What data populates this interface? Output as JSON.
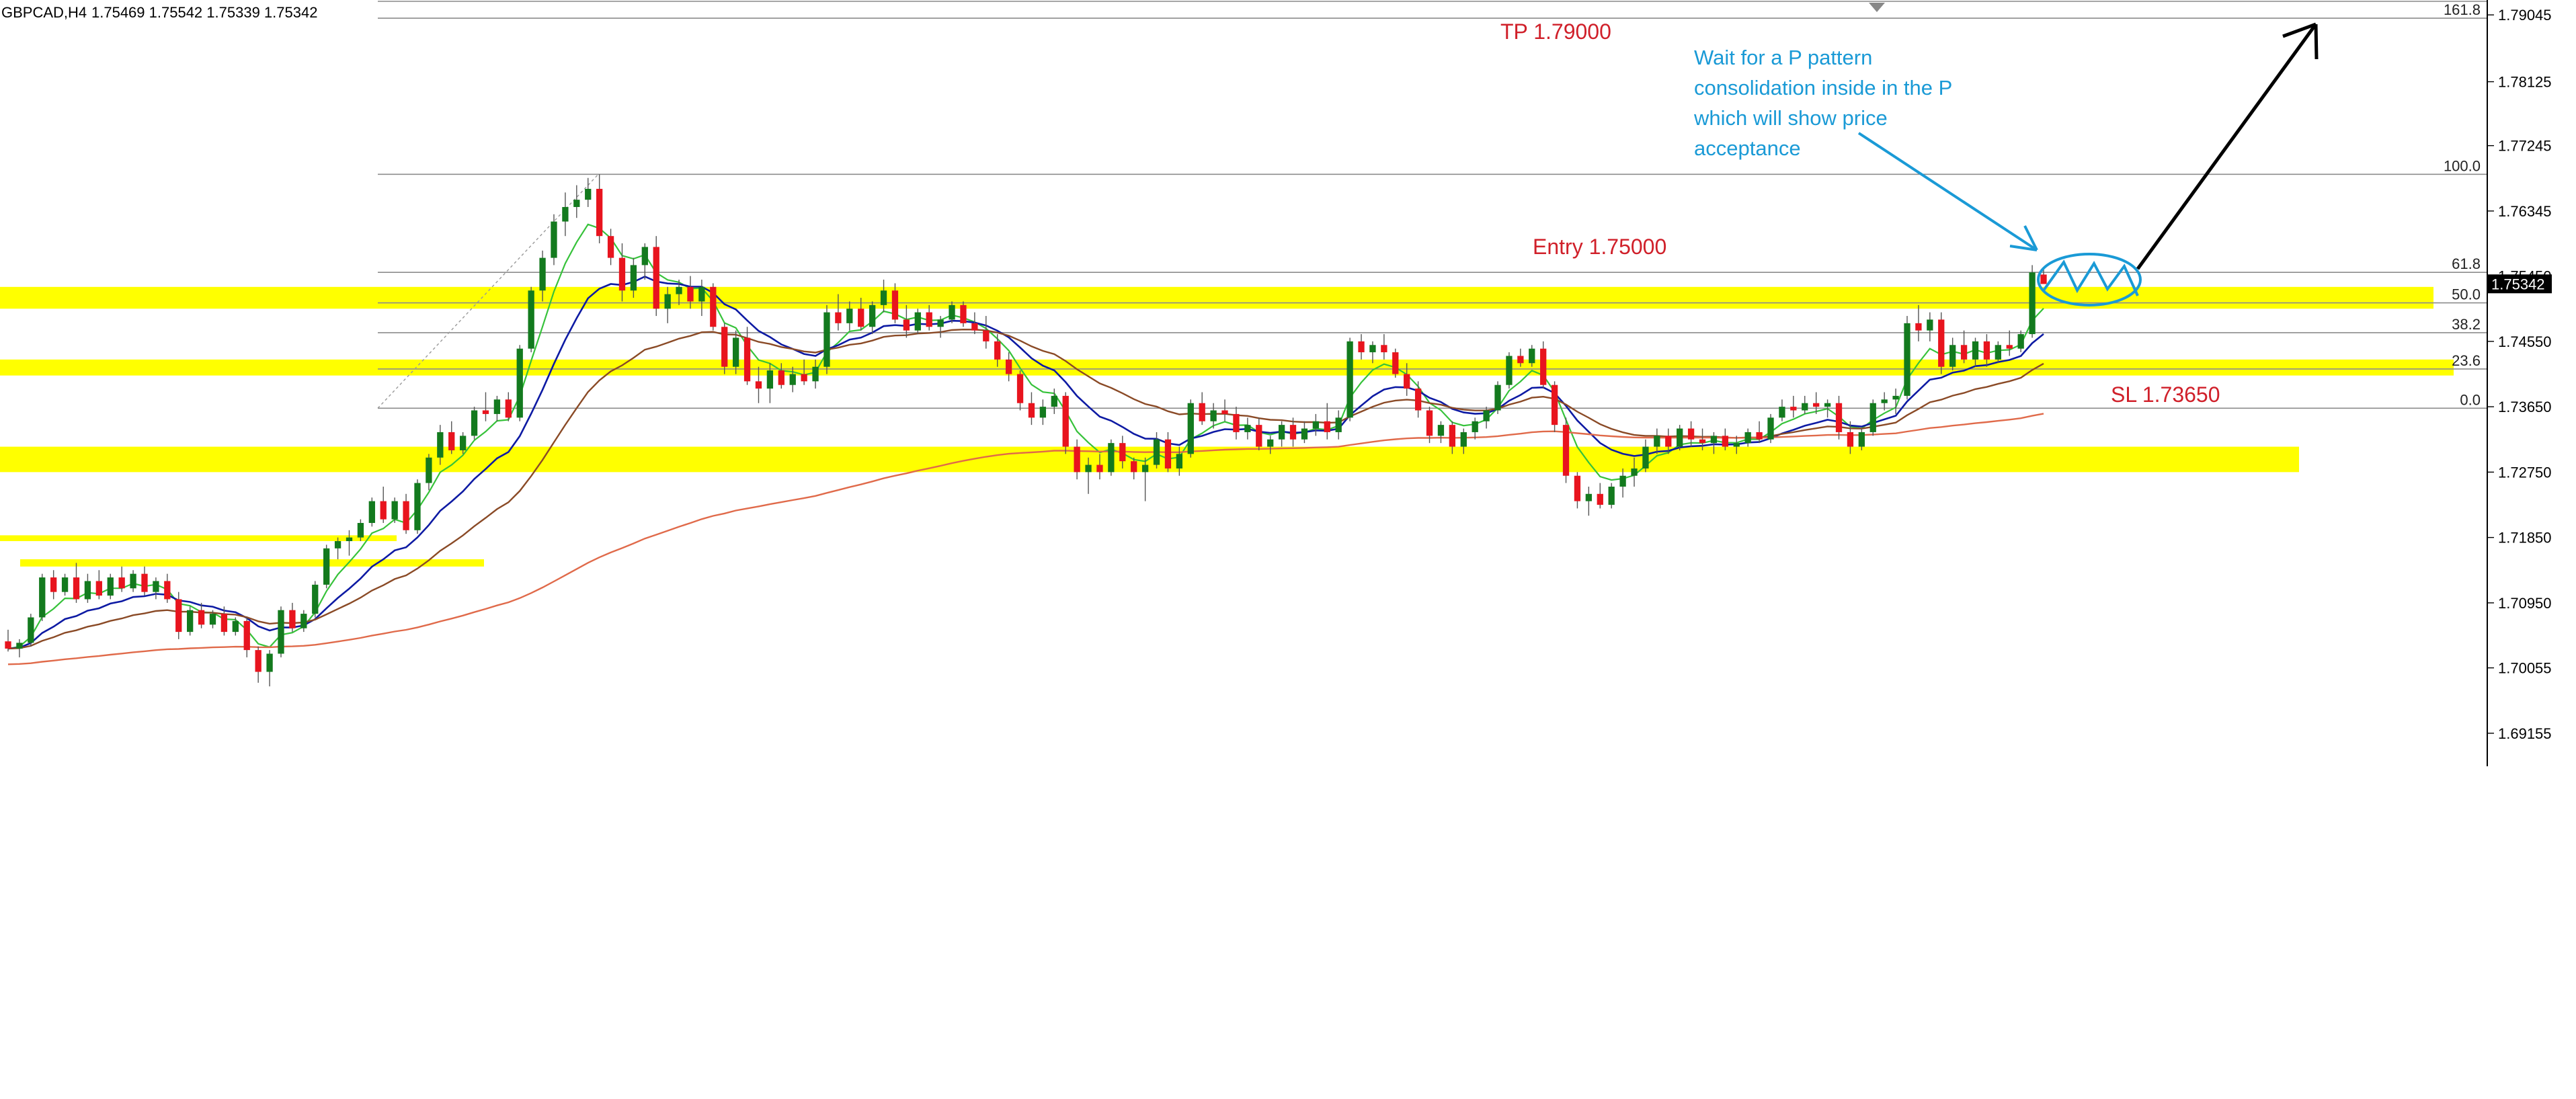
{
  "header": {
    "symbol_timeframe": "GBPCAD,H4",
    "ohlc": "1.75469 1.75542 1.75339 1.75342"
  },
  "colors": {
    "background": "#ffffff",
    "bull": "#137a1e",
    "bear": "#e8141e",
    "zone": "#ffff00",
    "ema_fast": "#36c23a",
    "ema_mid": "#0d1aa3",
    "ema_slow": "#8a4a26",
    "ema_long": "#e06a4a",
    "fib": "#8c8c8c",
    "annotation_red": "#d0202a",
    "annotation_blue": "#1a9ad6",
    "arrow_black": "#000000"
  },
  "annotations": {
    "tp": "TP 1.79000",
    "entry": "Entry 1.75000",
    "sl": "SL 1.73650",
    "note": [
      "Wait for a P pattern",
      "consolidation inside in the P",
      "which will show price",
      "acceptance"
    ]
  },
  "chart_data": {
    "type": "candlestick",
    "symbol": "GBPCAD",
    "timeframe": "H4",
    "ylim": [
      1.687,
      1.7925
    ],
    "price_axis_ticks": [
      "1.79045",
      "1.78125",
      "1.77245",
      "1.76345",
      "1.75450",
      "1.74550",
      "1.73650",
      "1.72750",
      "1.71850",
      "1.70950",
      "1.70055",
      "1.69155"
    ],
    "current_price": "1.75342",
    "candles_approx": [
      [
        1.7042,
        1.7058,
        1.7028,
        1.7032
      ],
      [
        1.7032,
        1.7045,
        1.702,
        1.704
      ],
      [
        1.704,
        1.708,
        1.7035,
        1.7075
      ],
      [
        1.7075,
        1.7135,
        1.707,
        1.713
      ],
      [
        1.713,
        1.714,
        1.71,
        1.711
      ],
      [
        1.711,
        1.7135,
        1.7105,
        1.713
      ],
      [
        1.713,
        1.715,
        1.7095,
        1.71
      ],
      [
        1.71,
        1.7135,
        1.7095,
        1.7125
      ],
      [
        1.7125,
        1.714,
        1.71,
        1.7105
      ],
      [
        1.7105,
        1.7135,
        1.71,
        1.713
      ],
      [
        1.713,
        1.7145,
        1.711,
        1.7115
      ],
      [
        1.7115,
        1.714,
        1.711,
        1.7135
      ],
      [
        1.7135,
        1.7145,
        1.7105,
        1.711
      ],
      [
        1.711,
        1.713,
        1.71,
        1.7125
      ],
      [
        1.7125,
        1.7135,
        1.7095,
        1.71
      ],
      [
        1.71,
        1.711,
        1.7045,
        1.7055
      ],
      [
        1.7055,
        1.709,
        1.705,
        1.7085
      ],
      [
        1.7085,
        1.7095,
        1.706,
        1.7065
      ],
      [
        1.7065,
        1.7085,
        1.706,
        1.708
      ],
      [
        1.708,
        1.709,
        1.705,
        1.7055
      ],
      [
        1.7055,
        1.7075,
        1.705,
        1.707
      ],
      [
        1.707,
        1.7075,
        1.702,
        1.703
      ],
      [
        1.703,
        1.7035,
        1.6985,
        1.7
      ],
      [
        1.7,
        1.703,
        1.698,
        1.7025
      ],
      [
        1.7025,
        1.709,
        1.702,
        1.7085
      ],
      [
        1.7085,
        1.7095,
        1.7055,
        1.706
      ],
      [
        1.706,
        1.7085,
        1.7055,
        1.708
      ],
      [
        1.708,
        1.7125,
        1.7075,
        1.712
      ],
      [
        1.712,
        1.7175,
        1.7115,
        1.717
      ],
      [
        1.717,
        1.7185,
        1.7155,
        1.718
      ],
      [
        1.718,
        1.7195,
        1.716,
        1.7185
      ],
      [
        1.7185,
        1.721,
        1.718,
        1.7205
      ],
      [
        1.7205,
        1.724,
        1.72,
        1.7235
      ],
      [
        1.7235,
        1.7255,
        1.7205,
        1.721
      ],
      [
        1.721,
        1.724,
        1.7205,
        1.7235
      ],
      [
        1.7235,
        1.7245,
        1.719,
        1.7195
      ],
      [
        1.7195,
        1.7265,
        1.719,
        1.726
      ],
      [
        1.726,
        1.73,
        1.725,
        1.7295
      ],
      [
        1.7295,
        1.734,
        1.7285,
        1.733
      ],
      [
        1.733,
        1.7345,
        1.73,
        1.7305
      ],
      [
        1.7305,
        1.733,
        1.73,
        1.7325
      ],
      [
        1.7325,
        1.7365,
        1.732,
        1.736
      ],
      [
        1.736,
        1.7385,
        1.7345,
        1.7355
      ],
      [
        1.7355,
        1.738,
        1.7345,
        1.7375
      ],
      [
        1.7375,
        1.7385,
        1.7345,
        1.735
      ],
      [
        1.735,
        1.745,
        1.7345,
        1.7445
      ],
      [
        1.7445,
        1.753,
        1.744,
        1.7525
      ],
      [
        1.7525,
        1.758,
        1.751,
        1.757
      ],
      [
        1.757,
        1.763,
        1.756,
        1.762
      ],
      [
        1.762,
        1.766,
        1.76,
        1.764
      ],
      [
        1.764,
        1.767,
        1.7625,
        1.765
      ],
      [
        1.765,
        1.768,
        1.764,
        1.7665
      ],
      [
        1.7665,
        1.7685,
        1.759,
        1.76
      ],
      [
        1.76,
        1.761,
        1.756,
        1.757
      ],
      [
        1.757,
        1.759,
        1.751,
        1.7525
      ],
      [
        1.7525,
        1.757,
        1.7515,
        1.756
      ],
      [
        1.756,
        1.759,
        1.754,
        1.7585
      ],
      [
        1.7585,
        1.76,
        1.749,
        1.75
      ],
      [
        1.75,
        1.753,
        1.748,
        1.752
      ],
      [
        1.752,
        1.754,
        1.7505,
        1.753
      ],
      [
        1.753,
        1.7545,
        1.75,
        1.751
      ],
      [
        1.751,
        1.754,
        1.749,
        1.753
      ],
      [
        1.753,
        1.7535,
        1.747,
        1.7475
      ],
      [
        1.7475,
        1.748,
        1.741,
        1.742
      ],
      [
        1.742,
        1.747,
        1.741,
        1.746
      ],
      [
        1.746,
        1.7475,
        1.7395,
        1.74
      ],
      [
        1.74,
        1.742,
        1.737,
        1.739
      ],
      [
        1.739,
        1.7425,
        1.737,
        1.7415
      ],
      [
        1.7415,
        1.7425,
        1.739,
        1.7395
      ],
      [
        1.7395,
        1.742,
        1.7385,
        1.741
      ],
      [
        1.741,
        1.743,
        1.7395,
        1.74
      ],
      [
        1.74,
        1.743,
        1.739,
        1.742
      ],
      [
        1.742,
        1.7505,
        1.741,
        1.7495
      ],
      [
        1.7495,
        1.752,
        1.747,
        1.748
      ],
      [
        1.748,
        1.751,
        1.747,
        1.75
      ],
      [
        1.75,
        1.7515,
        1.747,
        1.7475
      ],
      [
        1.7475,
        1.751,
        1.7465,
        1.7505
      ],
      [
        1.7505,
        1.754,
        1.7495,
        1.7525
      ],
      [
        1.7525,
        1.7535,
        1.748,
        1.7485
      ],
      [
        1.7485,
        1.7505,
        1.746,
        1.747
      ],
      [
        1.747,
        1.75,
        1.7465,
        1.7495
      ],
      [
        1.7495,
        1.7505,
        1.747,
        1.7475
      ],
      [
        1.7475,
        1.749,
        1.746,
        1.7485
      ],
      [
        1.7485,
        1.751,
        1.748,
        1.7505
      ],
      [
        1.7505,
        1.751,
        1.7475,
        1.748
      ],
      [
        1.748,
        1.7495,
        1.7465,
        1.747
      ],
      [
        1.747,
        1.749,
        1.7445,
        1.7455
      ],
      [
        1.7455,
        1.7465,
        1.742,
        1.743
      ],
      [
        1.743,
        1.744,
        1.74,
        1.741
      ],
      [
        1.741,
        1.7415,
        1.736,
        1.737
      ],
      [
        1.737,
        1.7385,
        1.734,
        1.735
      ],
      [
        1.735,
        1.7375,
        1.734,
        1.7365
      ],
      [
        1.7365,
        1.739,
        1.7355,
        1.738
      ],
      [
        1.738,
        1.7385,
        1.73,
        1.731
      ],
      [
        1.731,
        1.732,
        1.7265,
        1.7275
      ],
      [
        1.7275,
        1.7295,
        1.7245,
        1.7285
      ],
      [
        1.7285,
        1.73,
        1.7265,
        1.7275
      ],
      [
        1.7275,
        1.732,
        1.727,
        1.7315
      ],
      [
        1.7315,
        1.7325,
        1.728,
        1.729
      ],
      [
        1.729,
        1.7295,
        1.7265,
        1.7275
      ],
      [
        1.7275,
        1.7295,
        1.7235,
        1.7285
      ],
      [
        1.7285,
        1.733,
        1.728,
        1.732
      ],
      [
        1.732,
        1.733,
        1.7275,
        1.728
      ],
      [
        1.728,
        1.731,
        1.727,
        1.73
      ],
      [
        1.73,
        1.7375,
        1.7295,
        1.737
      ],
      [
        1.737,
        1.7385,
        1.734,
        1.7345
      ],
      [
        1.7345,
        1.737,
        1.7335,
        1.736
      ],
      [
        1.736,
        1.7375,
        1.7345,
        1.7355
      ],
      [
        1.7355,
        1.7365,
        1.732,
        1.733
      ],
      [
        1.733,
        1.735,
        1.732,
        1.734
      ],
      [
        1.734,
        1.735,
        1.7305,
        1.731
      ],
      [
        1.731,
        1.7325,
        1.73,
        1.732
      ],
      [
        1.732,
        1.7345,
        1.731,
        1.734
      ],
      [
        1.734,
        1.735,
        1.731,
        1.732
      ],
      [
        1.732,
        1.7345,
        1.7315,
        1.7335
      ],
      [
        1.7335,
        1.7355,
        1.7325,
        1.7345
      ],
      [
        1.7345,
        1.737,
        1.732,
        1.733
      ],
      [
        1.733,
        1.736,
        1.732,
        1.735
      ],
      [
        1.735,
        1.746,
        1.7345,
        1.7455
      ],
      [
        1.7455,
        1.7465,
        1.743,
        1.744
      ],
      [
        1.744,
        1.7455,
        1.7425,
        1.745
      ],
      [
        1.745,
        1.7465,
        1.743,
        1.744
      ],
      [
        1.744,
        1.7445,
        1.7405,
        1.741
      ],
      [
        1.741,
        1.7425,
        1.738,
        1.739
      ],
      [
        1.739,
        1.74,
        1.735,
        1.736
      ],
      [
        1.736,
        1.7365,
        1.7315,
        1.7325
      ],
      [
        1.7325,
        1.7345,
        1.7315,
        1.734
      ],
      [
        1.734,
        1.7345,
        1.73,
        1.731
      ],
      [
        1.731,
        1.7335,
        1.73,
        1.733
      ],
      [
        1.733,
        1.735,
        1.732,
        1.7345
      ],
      [
        1.7345,
        1.7365,
        1.7335,
        1.736
      ],
      [
        1.736,
        1.74,
        1.7355,
        1.7395
      ],
      [
        1.7395,
        1.744,
        1.739,
        1.7435
      ],
      [
        1.7435,
        1.7445,
        1.742,
        1.7425
      ],
      [
        1.7425,
        1.745,
        1.742,
        1.7445
      ],
      [
        1.7445,
        1.7455,
        1.739,
        1.7395
      ],
      [
        1.7395,
        1.74,
        1.733,
        1.734
      ],
      [
        1.734,
        1.735,
        1.726,
        1.727
      ],
      [
        1.727,
        1.7275,
        1.7225,
        1.7235
      ],
      [
        1.7235,
        1.7255,
        1.7215,
        1.7245
      ],
      [
        1.7245,
        1.726,
        1.7225,
        1.723
      ],
      [
        1.723,
        1.726,
        1.7225,
        1.7255
      ],
      [
        1.7255,
        1.728,
        1.724,
        1.727
      ],
      [
        1.727,
        1.7295,
        1.7255,
        1.728
      ],
      [
        1.728,
        1.732,
        1.7275,
        1.731
      ],
      [
        1.731,
        1.7335,
        1.73,
        1.7325
      ],
      [
        1.7325,
        1.7335,
        1.73,
        1.731
      ],
      [
        1.731,
        1.734,
        1.7305,
        1.7335
      ],
      [
        1.7335,
        1.7345,
        1.731,
        1.732
      ],
      [
        1.732,
        1.7335,
        1.7305,
        1.7315
      ],
      [
        1.7315,
        1.733,
        1.73,
        1.7325
      ],
      [
        1.7325,
        1.7335,
        1.7305,
        1.731
      ],
      [
        1.731,
        1.7325,
        1.73,
        1.7315
      ],
      [
        1.7315,
        1.7335,
        1.731,
        1.733
      ],
      [
        1.733,
        1.7345,
        1.7315,
        1.732
      ],
      [
        1.732,
        1.7355,
        1.7315,
        1.735
      ],
      [
        1.735,
        1.7375,
        1.7345,
        1.7365
      ],
      [
        1.7365,
        1.738,
        1.735,
        1.736
      ],
      [
        1.736,
        1.738,
        1.7355,
        1.737
      ],
      [
        1.737,
        1.7385,
        1.7355,
        1.7365
      ],
      [
        1.7365,
        1.7375,
        1.735,
        1.737
      ],
      [
        1.737,
        1.738,
        1.732,
        1.733
      ],
      [
        1.733,
        1.7345,
        1.73,
        1.731
      ],
      [
        1.731,
        1.7335,
        1.7305,
        1.733
      ],
      [
        1.733,
        1.7375,
        1.7325,
        1.737
      ],
      [
        1.737,
        1.7385,
        1.736,
        1.7375
      ],
      [
        1.7375,
        1.739,
        1.7355,
        1.738
      ],
      [
        1.738,
        1.749,
        1.7375,
        1.748
      ],
      [
        1.748,
        1.7505,
        1.7455,
        1.747
      ],
      [
        1.747,
        1.7495,
        1.7455,
        1.7485
      ],
      [
        1.7485,
        1.7495,
        1.741,
        1.742
      ],
      [
        1.742,
        1.746,
        1.7415,
        1.745
      ],
      [
        1.745,
        1.747,
        1.7425,
        1.743
      ],
      [
        1.743,
        1.746,
        1.742,
        1.7455
      ],
      [
        1.7455,
        1.7465,
        1.742,
        1.743
      ],
      [
        1.743,
        1.7455,
        1.7425,
        1.745
      ],
      [
        1.745,
        1.747,
        1.7435,
        1.7445
      ],
      [
        1.7445,
        1.747,
        1.744,
        1.7465
      ],
      [
        1.7465,
        1.756,
        1.746,
        1.755
      ],
      [
        1.7547,
        1.7554,
        1.7534,
        1.7534
      ]
    ],
    "zones": [
      {
        "from": 1.753,
        "to": 1.75
      },
      {
        "from": 1.743,
        "to": 1.7408
      },
      {
        "from": 1.731,
        "to": 1.7275
      },
      {
        "from": 1.7188,
        "to": 1.718
      },
      {
        "from": 1.7155,
        "to": 1.7145
      }
    ],
    "fibonacci": [
      {
        "label": "161.8",
        "price": 1.79
      },
      {
        "label": "100.0",
        "price": 1.7685
      },
      {
        "label": "61.8",
        "price": 1.755
      },
      {
        "label": "50.0",
        "price": 1.7508
      },
      {
        "label": "38.2",
        "price": 1.7467
      },
      {
        "label": "23.6",
        "price": 1.7417
      },
      {
        "label": "0.0",
        "price": 1.7363
      }
    ],
    "ema_periods_shown": 4,
    "legend": "none",
    "grid": false
  }
}
